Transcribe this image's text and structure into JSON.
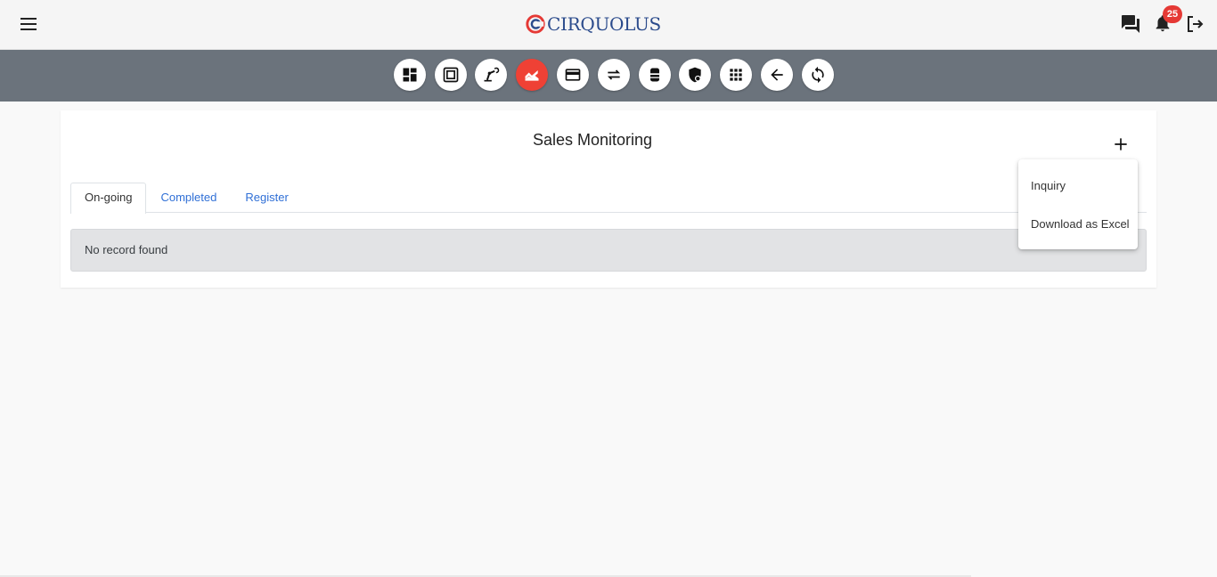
{
  "header": {
    "logo_text": "CIRQUOLUS",
    "notification_count": "25",
    "icons": [
      "hamburger-menu-icon",
      "chat-icon",
      "bell-icon",
      "logout-icon"
    ]
  },
  "toolbar": {
    "buttons": [
      {
        "icon": "dashboard-icon",
        "active": false
      },
      {
        "icon": "frame-icon",
        "active": false
      },
      {
        "icon": "machine-arm-icon",
        "active": false
      },
      {
        "icon": "sales-chart-icon",
        "active": true
      },
      {
        "icon": "credit-card-icon",
        "active": false
      },
      {
        "icon": "transfer-arrows-icon",
        "active": false
      },
      {
        "icon": "drum-icon",
        "active": false
      },
      {
        "icon": "shield-icon",
        "active": false
      },
      {
        "icon": "apps-grid-icon",
        "active": false
      },
      {
        "icon": "back-arrow-icon",
        "active": false
      },
      {
        "icon": "refresh-icon",
        "active": false
      }
    ],
    "active_color": "#ef4135",
    "background": "#6b737c"
  },
  "main": {
    "title": "Sales Monitoring",
    "tabs": [
      {
        "label": "On-going",
        "active": true
      },
      {
        "label": "Completed",
        "active": false
      },
      {
        "label": "Register",
        "active": false
      }
    ],
    "empty_message": "No record found"
  },
  "menu": {
    "items": [
      {
        "label": "Inquiry"
      },
      {
        "label": "Download as Excel"
      }
    ]
  }
}
